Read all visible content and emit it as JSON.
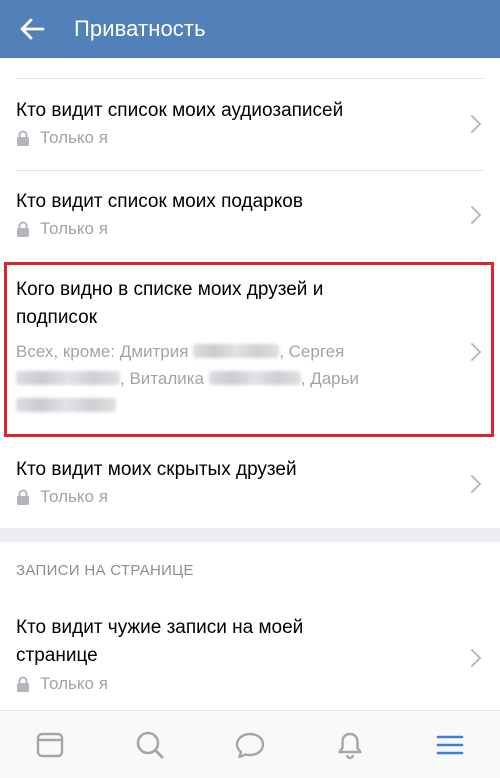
{
  "app_bar": {
    "title": "Приватность"
  },
  "items": [
    {
      "title": "Кто видит список моих аудиозаписей",
      "value": "Только я"
    },
    {
      "title": "Кто видит список моих подарков",
      "value": "Только я"
    },
    {
      "title_line1": "Кого видно в списке моих друзей и",
      "title_line2": "подписок",
      "except_prefix": "Всех, кроме: Дмитрия",
      "name2": ", Сергея",
      "name3": ", Виталика",
      "name4": ", Дарьи"
    },
    {
      "title": "Кто видит моих скрытых друзей",
      "value": "Только я"
    }
  ],
  "section": {
    "header": "ЗАПИСИ НА СТРАНИЦЕ"
  },
  "section_items": [
    {
      "title_line1": "Кто видит чужие записи на моей",
      "title_line2": "странице",
      "value": "Только я"
    }
  ],
  "bottom_nav": [
    "news-icon",
    "search-icon",
    "messages-icon",
    "notifications-icon",
    "menu-icon"
  ],
  "colors": {
    "header": "#5181b8",
    "highlight": "#e0242a",
    "active": "#3f7fd0",
    "inactive": "#a2a6ad"
  }
}
